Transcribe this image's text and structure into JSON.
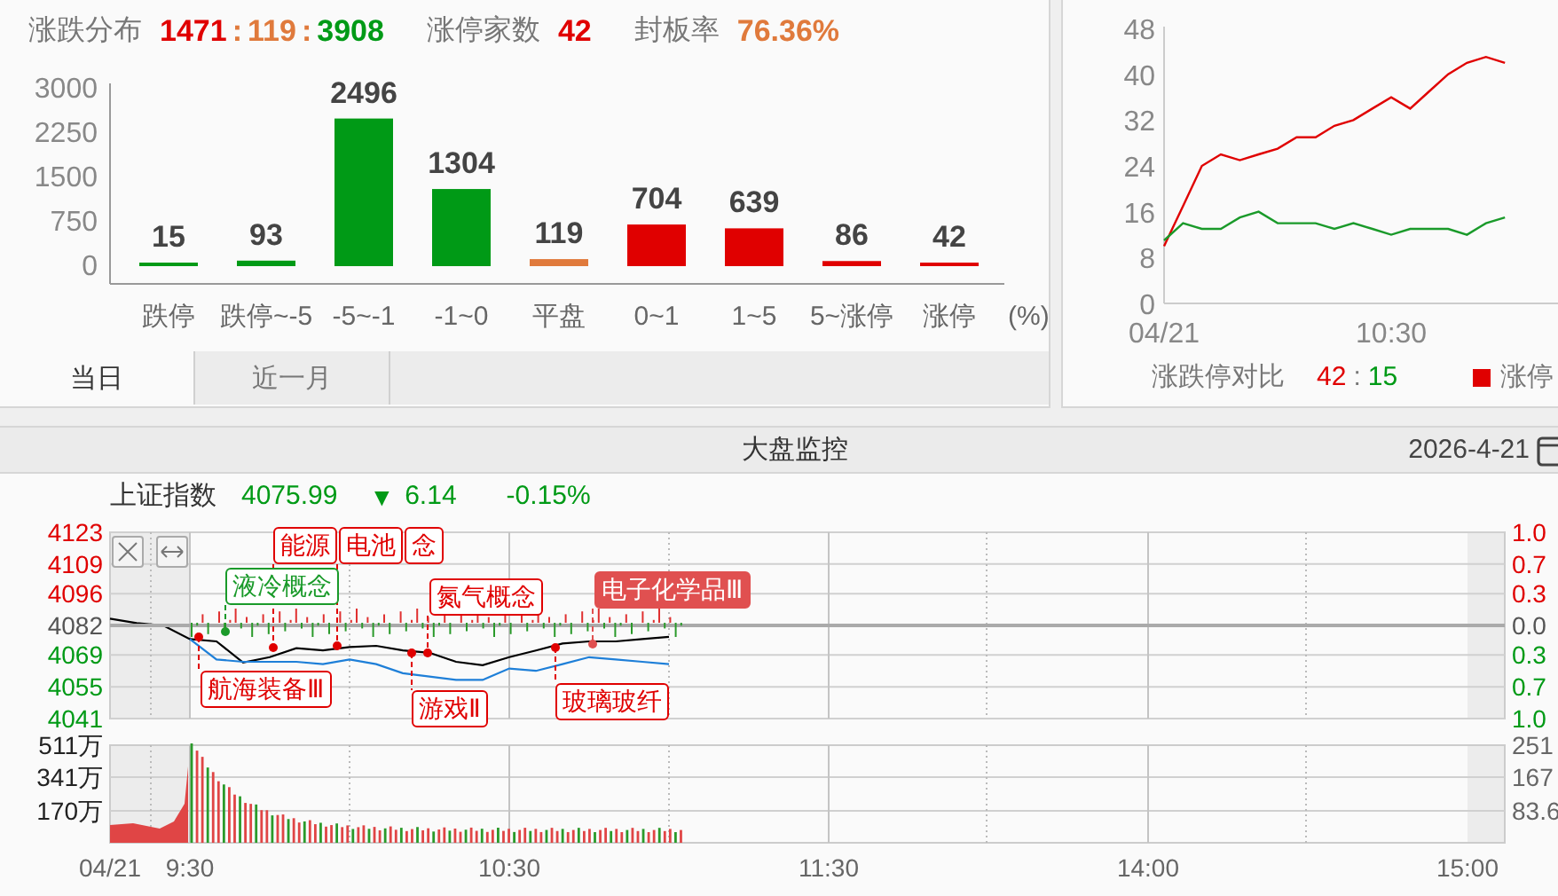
{
  "distribution": {
    "title": "涨跌分布",
    "ratio": [
      {
        "text": "1471",
        "color": "#e00000"
      },
      {
        "text": ":",
        "color": "#e07a3c"
      },
      {
        "text": "119",
        "color": "#e07a3c"
      },
      {
        "text": ":",
        "color": "#e07a3c"
      },
      {
        "text": "3908",
        "color": "#009a16"
      }
    ],
    "limit_up_label": "涨停家数",
    "limit_up_count": "42",
    "seal_rate_label": "封板率",
    "seal_rate": "76.36%",
    "chart_data": {
      "type": "bar",
      "categories": [
        "跌停",
        "跌停~-5",
        "-5~-1",
        "-1~0",
        "平盘",
        "0~1",
        "1~5",
        "5~涨停",
        "涨停"
      ],
      "xlabel": "(%)",
      "stacked": true,
      "ylim": [
        0,
        3000
      ],
      "yticks": [
        0,
        750,
        1500,
        2250,
        3000
      ],
      "data_labels": true,
      "series": [
        {
          "color": "#009a16",
          "values": [
            15,
            93,
            2496,
            1304,
            null,
            null,
            null,
            null,
            null
          ]
        },
        {
          "color": "#e07a3c",
          "values": [
            null,
            null,
            null,
            null,
            119,
            null,
            null,
            null,
            null
          ]
        },
        {
          "color": "#e00000",
          "values": [
            null,
            null,
            null,
            null,
            null,
            704,
            639,
            86,
            42
          ]
        }
      ]
    },
    "tabs": [
      {
        "label": "当日",
        "selected": true
      },
      {
        "label": "近一月",
        "selected": false
      }
    ]
  },
  "limit_chart": {
    "chart_data": {
      "type": "line",
      "categories": [
        "04/21",
        null,
        null,
        null,
        null,
        null,
        null,
        null,
        null,
        null,
        null,
        null,
        "10:30",
        null,
        null,
        null,
        null,
        null,
        null
      ],
      "ylim": [
        0,
        48
      ],
      "yticks": [
        0,
        8,
        16,
        24,
        32,
        40,
        48
      ],
      "series": [
        {
          "color": "#e00000",
          "values": [
            10,
            17,
            24,
            26,
            25,
            26,
            27,
            29,
            29,
            31,
            32,
            34,
            36,
            34,
            37,
            40,
            42,
            43,
            42
          ]
        },
        {
          "color": "#1a9a2a",
          "values": [
            11,
            14,
            13,
            13,
            15,
            16,
            14,
            14,
            14,
            13,
            14,
            13,
            12,
            13,
            13,
            13,
            12,
            14,
            15
          ]
        }
      ]
    },
    "legend": {
      "label": "涨跌停对比",
      "up": "42",
      "separator": ":",
      "down": "15",
      "series_label": "涨停"
    }
  },
  "monitor": {
    "title": "大盘监控",
    "date": "2026-4-21",
    "index": {
      "name": "上证指数",
      "price": "4075.99",
      "arrow": "▼",
      "change": "6.14",
      "change_pct": "-0.15%"
    },
    "chart_data": {
      "type": "line",
      "grid": true,
      "ylim": [
        4041,
        4123
      ],
      "categories": [
        "04/21",
        null,
        null,
        "9:30",
        null,
        null,
        null,
        null,
        null,
        null,
        null,
        null,
        null,
        null,
        null,
        "10:30",
        null,
        null,
        null,
        null,
        null,
        null,
        null,
        null,
        null,
        null,
        null,
        "11:30",
        null,
        null,
        null,
        null,
        null,
        null,
        null,
        null,
        null,
        null,
        null,
        "14:00",
        null,
        null,
        null,
        null,
        null,
        null,
        null,
        null,
        null,
        null,
        null,
        "15:00"
      ],
      "yticks": [
        4123,
        4109,
        4096,
        4082,
        4069,
        4055,
        4041
      ],
      "series": [
        {
          "color": "#000000",
          "values": [
            4085,
            4083,
            4082,
            4076,
            4075,
            4065.7,
            4068,
            4072,
            4071,
            4072.5,
            4073,
            4071,
            4070,
            4066,
            4064.5,
            4068,
            4071,
            4074,
            4075,
            4075,
            4076,
            4077,
            null,
            null,
            null,
            null,
            null,
            null,
            null,
            null,
            null,
            null,
            null,
            null,
            null,
            null,
            null,
            null,
            null,
            null,
            null,
            null,
            null,
            null,
            null,
            null,
            null,
            null,
            null,
            null,
            null,
            null
          ]
        },
        {
          "color": "#1e7fd8",
          "values": [
            null,
            null,
            null,
            4076,
            4067,
            4066,
            4066,
            4066,
            4065,
            4067,
            4065,
            4061,
            4059.5,
            4058,
            4058,
            4063,
            4062,
            4065,
            4068,
            4067,
            4066,
            4065,
            null,
            null,
            null,
            null,
            null,
            null,
            null,
            null,
            null,
            null,
            null,
            null,
            null,
            null,
            null,
            null,
            null,
            null,
            null,
            null,
            null,
            null,
            null,
            null,
            null,
            null,
            null,
            null,
            null,
            null
          ]
        }
      ]
    },
    "price_labels": [
      {
        "text": "4123",
        "color": "#e00000"
      },
      {
        "text": "4109",
        "color": "#e00000"
      },
      {
        "text": "4096",
        "color": "#e00000"
      },
      {
        "text": "4082",
        "color": "#555555"
      },
      {
        "text": "4069",
        "color": "#009a16"
      },
      {
        "text": "4055",
        "color": "#009a16"
      },
      {
        "text": "4041",
        "color": "#009a16"
      }
    ],
    "percent_labels": [
      {
        "text": "1.0",
        "color": "#e00000"
      },
      {
        "text": "0.7",
        "color": "#e00000"
      },
      {
        "text": "0.3",
        "color": "#e00000"
      },
      {
        "text": "0.0",
        "color": "#555555"
      },
      {
        "text": "0.3",
        "color": "#009a16"
      },
      {
        "text": "0.7",
        "color": "#009a16"
      },
      {
        "text": "1.0",
        "color": "#009a16"
      }
    ],
    "events": [
      {
        "text": "能源",
        "color": "#e00000",
        "kind": "outline"
      },
      {
        "text": "电池",
        "color": "#e00000",
        "kind": "outline"
      },
      {
        "text": "念",
        "color": "#e00000",
        "kind": "outline"
      },
      {
        "text": "液冷概念",
        "color": "#1a9a2a",
        "kind": "outline"
      },
      {
        "text": "氮气概念",
        "color": "#e00000",
        "kind": "outline"
      },
      {
        "text": "电子化学品Ⅲ",
        "color": "#e05050",
        "kind": "filled"
      },
      {
        "text": "航海装备Ⅲ",
        "color": "#e00000",
        "kind": "outline"
      },
      {
        "text": "玻璃玻纤",
        "color": "#e00000",
        "kind": "outline"
      },
      {
        "text": "游戏Ⅱ",
        "color": "#e00000",
        "kind": "outline"
      }
    ],
    "volume_labels": [
      "511万",
      "341万",
      "170万"
    ],
    "volume_right_labels": [
      "251",
      "167",
      "83.6"
    ]
  }
}
